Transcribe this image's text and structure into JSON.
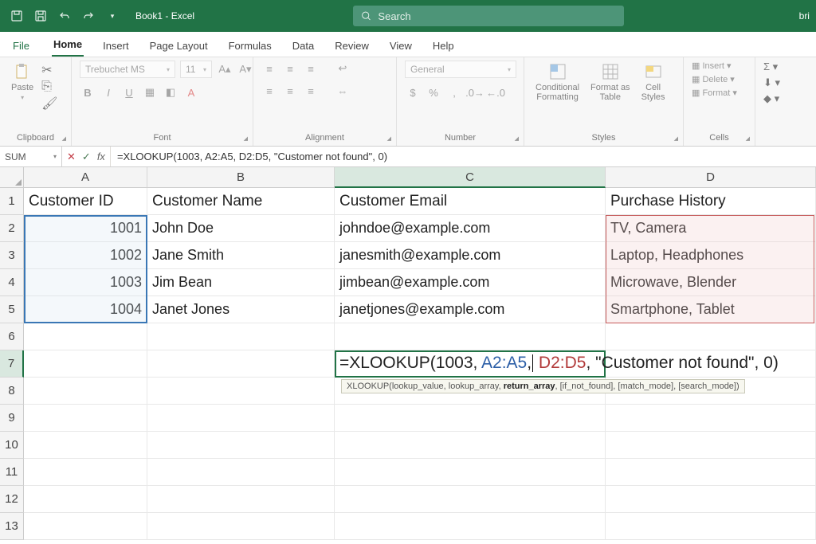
{
  "titlebar": {
    "title": "Book1 - Excel",
    "search_placeholder": "Search",
    "user": "bri"
  },
  "tabs": {
    "file": "File",
    "home": "Home",
    "insert": "Insert",
    "page_layout": "Page Layout",
    "formulas": "Formulas",
    "data": "Data",
    "review": "Review",
    "view": "View",
    "help": "Help"
  },
  "ribbon": {
    "clipboard": {
      "label": "Clipboard",
      "paste": "Paste"
    },
    "font": {
      "label": "Font",
      "name": "Trebuchet MS",
      "size": "11"
    },
    "alignment": {
      "label": "Alignment"
    },
    "number": {
      "label": "Number",
      "format": "General"
    },
    "styles": {
      "label": "Styles",
      "cond": "Conditional\nFormatting",
      "table": "Format as\nTable",
      "cell": "Cell\nStyles"
    },
    "cells": {
      "label": "Cells",
      "insert": "Insert",
      "delete": "Delete",
      "format": "Format"
    }
  },
  "fxbar": {
    "namebox": "SUM",
    "formula": "=XLOOKUP(1003, A2:A5, D2:D5, \"Customer not found\", 0)"
  },
  "columns": {
    "A": "A",
    "B": "B",
    "C": "C",
    "D": "D"
  },
  "sheet": {
    "h": {
      "A": "Customer ID",
      "B": "Customer Name",
      "C": "Customer Email",
      "D": "Purchase History"
    },
    "r2": {
      "A": "1001",
      "B": "John Doe",
      "C": "johndoe@example.com",
      "D": "TV, Camera"
    },
    "r3": {
      "A": "1002",
      "B": "Jane Smith",
      "C": "janesmith@example.com",
      "D": "Laptop, Headphones"
    },
    "r4": {
      "A": "1003",
      "B": "Jim Bean",
      "C": "jimbean@example.com",
      "D": "Microwave, Blender"
    },
    "r5": {
      "A": "1004",
      "B": "Janet Jones",
      "C": "janetjones@example.com",
      "D": "Smartphone, Tablet"
    }
  },
  "formula_cell": {
    "p1": "=XLOOKUP(1003, ",
    "p2": "A2:A5",
    "p3": ",",
    "p4": " D2:D5",
    "p5": ", \"Customer not found\", 0)"
  },
  "tooltip": {
    "p1": "XLOOKUP(lookup_value, lookup_array, ",
    "bold": "return_array",
    "p2": ", [if_not_found], [match_mode], [search_mode])"
  }
}
